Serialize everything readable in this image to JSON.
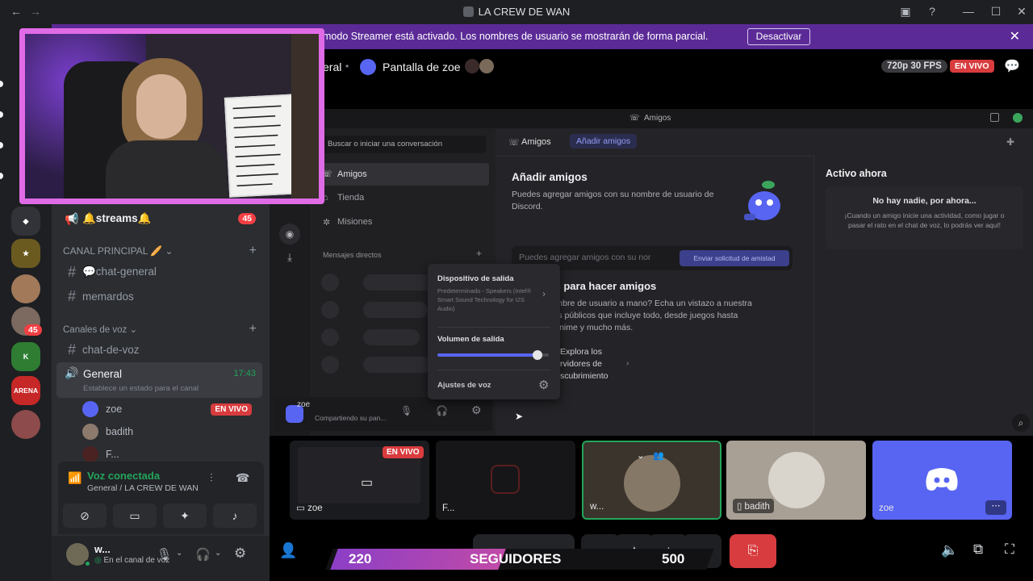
{
  "window": {
    "title": "LA CREW DE WAN"
  },
  "banner": {
    "text": "modo Streamer está activado. Los nombres de usuario se mostrarán de forma parcial.",
    "button": "Desactivar"
  },
  "servers": {
    "badge_1": "45",
    "arena_label": "ARENA"
  },
  "sidebar": {
    "streams_channel": "🔔streams🔔",
    "streams_badge": "45",
    "category_main": "CANAL PRINCIPAL 🥖",
    "channels_main": [
      "💬chat-general",
      "memardos"
    ],
    "category_voice": "Canales de voz",
    "voice_text_channel": "chat-de-voz",
    "voice_channel": "General",
    "voice_time": "17:43",
    "voice_status_hint": "Establece un estado para el canal",
    "voice_users": [
      {
        "name": "zoe",
        "live": "EN VIVO"
      },
      {
        "name": "badith"
      },
      {
        "name": "F..."
      }
    ]
  },
  "voice_panel": {
    "status": "Voz conectada",
    "location": "General / LA CREW DE WAN"
  },
  "user_panel": {
    "name": "w...",
    "status": "En el canal de voz"
  },
  "stage": {
    "crumb": "eral",
    "title": "Pantalla de zoe",
    "quality": "720p 30 FPS",
    "live": "EN VIVO"
  },
  "shared_screen": {
    "window_title": "Amigos",
    "search_placeholder": "Buscar o iniciar una conversación",
    "nav": [
      "Amigos",
      "Tienda",
      "Misiones"
    ],
    "dm_header": "Mensajes directos",
    "tab_friends": "Amigos",
    "tab_add": "Añadir amigos",
    "add_title": "Añadir amigos",
    "add_desc": "Puedes agregar amigos con su nombre de usuario de Discord.",
    "add_input": "Puedes agregar amigos con su nor",
    "add_button": "Enviar solicitud de amistad",
    "more_title": "ares para hacer amigos",
    "more_desc": "n nombre de usuario a mano? Echa un vistazo a nuestra\nidores públicos que incluye todo, desde juegos hasta\nica, anime y mucho más.",
    "explore": "Explora los\nrvidores de\nscubrimiento",
    "active_title": "Activo ahora",
    "active_empty": "No hay nadie, por ahora...",
    "active_desc": "¡Cuando un amigo inicie una actividad, como jugar o pasar el rato en el chat de voz, lo podrás ver aquí!",
    "popup": {
      "output_title": "Dispositivo de salida",
      "output_device": "Predeterminado - Speakers (Intel® Smart Sound Technology for I2S Audio)",
      "volume_title": "Volumen de salida",
      "volume_level": 0.9,
      "voice_settings": "Ajustes de voz"
    },
    "user_name": "zoe",
    "user_sub": "Compartiendo su pan..."
  },
  "tiles": [
    {
      "name": "zoe",
      "live": "EN VIVO"
    },
    {
      "name": "F..."
    },
    {
      "name": "w..."
    },
    {
      "name": "badith"
    },
    {
      "name": "zoe"
    }
  ],
  "followers": {
    "current": "220",
    "label": "SEGUIDORES",
    "goal": "500"
  },
  "colors": {
    "accent": "#5865f2",
    "live": "#d83c3e",
    "banner": "#5b2a97",
    "connected": "#23a55a",
    "cam_border": "#e06be6"
  }
}
